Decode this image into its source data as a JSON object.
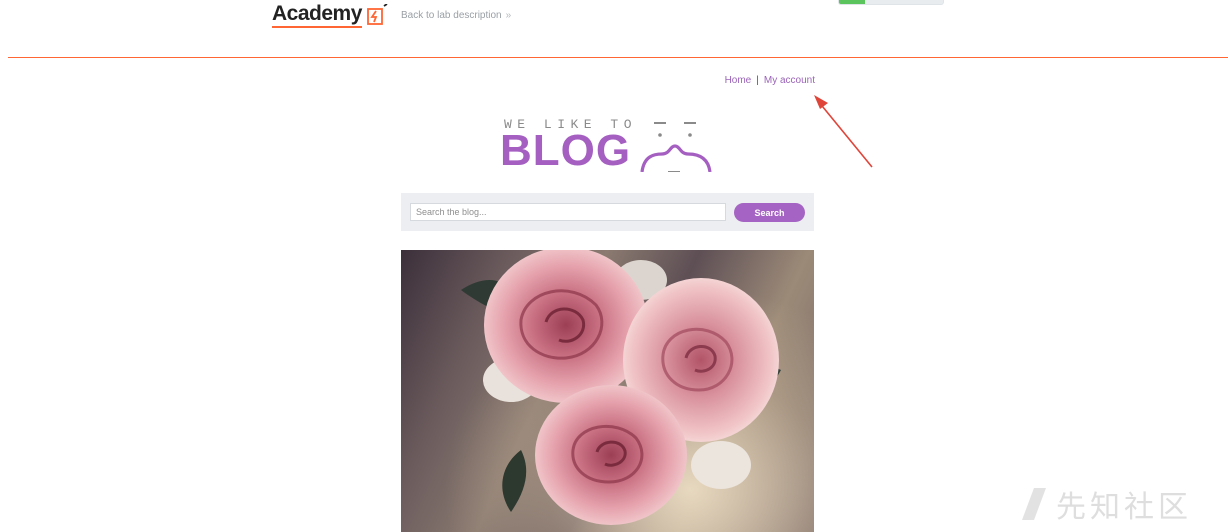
{
  "header": {
    "logo_text": "Academy",
    "back_link_label": "Back to lab description",
    "back_chevron": "»",
    "brand_color": "#ff6633"
  },
  "blog_nav": {
    "home_label": "Home",
    "separator": "|",
    "account_label": "My account"
  },
  "blog_logo": {
    "tagline": "WE LIKE TO",
    "title": "BLOG",
    "accent_color": "#a45fc1"
  },
  "search": {
    "placeholder": "Search the blog...",
    "value": "",
    "button_label": "Search"
  },
  "post": {
    "image_icon": "roses-photo"
  },
  "annotation": {
    "icon": "red-arrow-icon",
    "color": "#e0453a"
  },
  "watermark": {
    "text": "先知社区"
  }
}
